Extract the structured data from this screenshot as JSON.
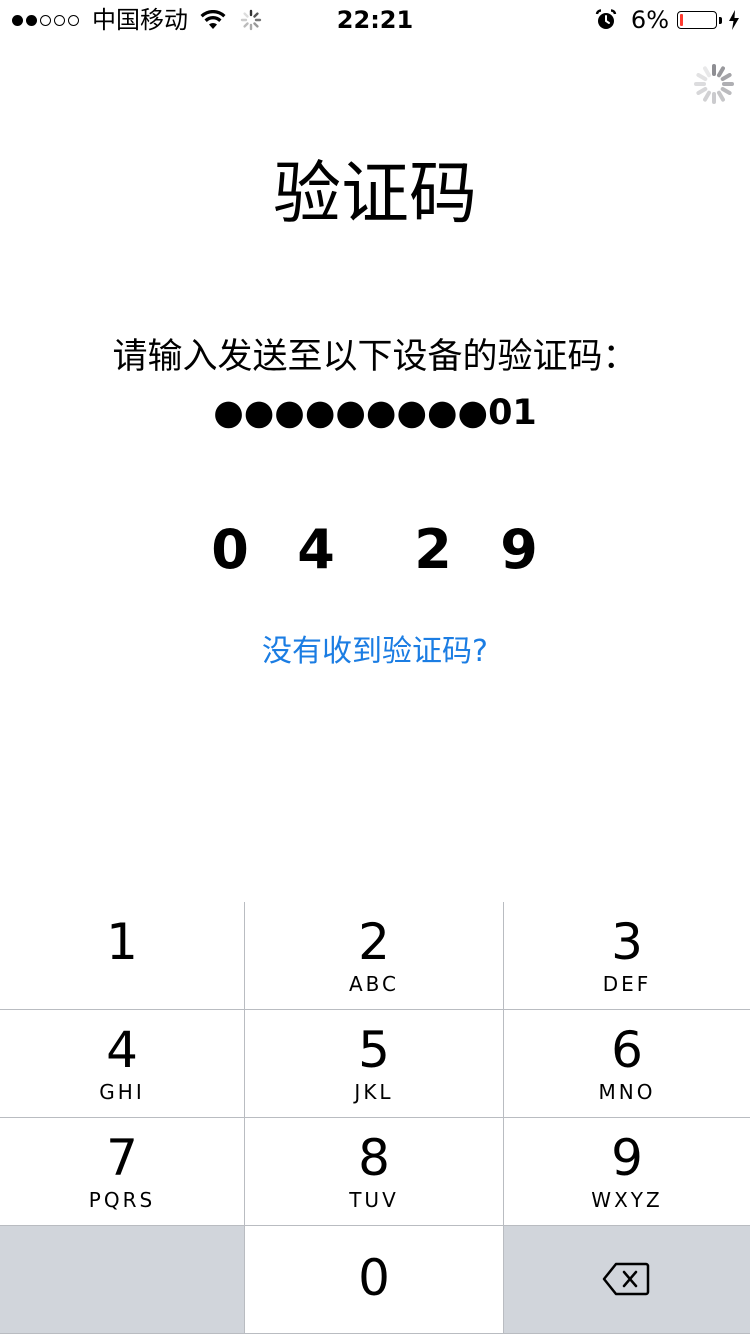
{
  "status_bar": {
    "signal_filled": 2,
    "signal_total": 5,
    "carrier": "中国移动",
    "time": "22:21",
    "battery_percent": "6%",
    "battery_level": 0.06,
    "battery_color": "#ff3b30",
    "icons": [
      "wifi-icon",
      "activity-spinner-icon",
      "alarm-icon",
      "battery-icon",
      "charging-bolt-icon"
    ]
  },
  "page": {
    "title": "验证码",
    "prompt": "请输入发送至以下设备的验证码：",
    "masked_phone": "●●●●●●●●●01",
    "code_digits": [
      "0",
      "4",
      "2",
      "9"
    ],
    "resend_link": "没有收到验证码?",
    "link_color": "#1b7de3",
    "loading_icon": "spinner-icon"
  },
  "keypad": {
    "keys": [
      {
        "num": "1",
        "letters": ""
      },
      {
        "num": "2",
        "letters": "ABC"
      },
      {
        "num": "3",
        "letters": "DEF"
      },
      {
        "num": "4",
        "letters": "GHI"
      },
      {
        "num": "5",
        "letters": "JKL"
      },
      {
        "num": "6",
        "letters": "MNO"
      },
      {
        "num": "7",
        "letters": "PQRS"
      },
      {
        "num": "8",
        "letters": "TUV"
      },
      {
        "num": "9",
        "letters": "WXYZ"
      },
      {
        "num": "",
        "letters": ""
      },
      {
        "num": "0",
        "letters": ""
      },
      {
        "num": "",
        "letters": "",
        "icon": "backspace-icon"
      }
    ],
    "gray_key_color": "#d1d5db"
  }
}
